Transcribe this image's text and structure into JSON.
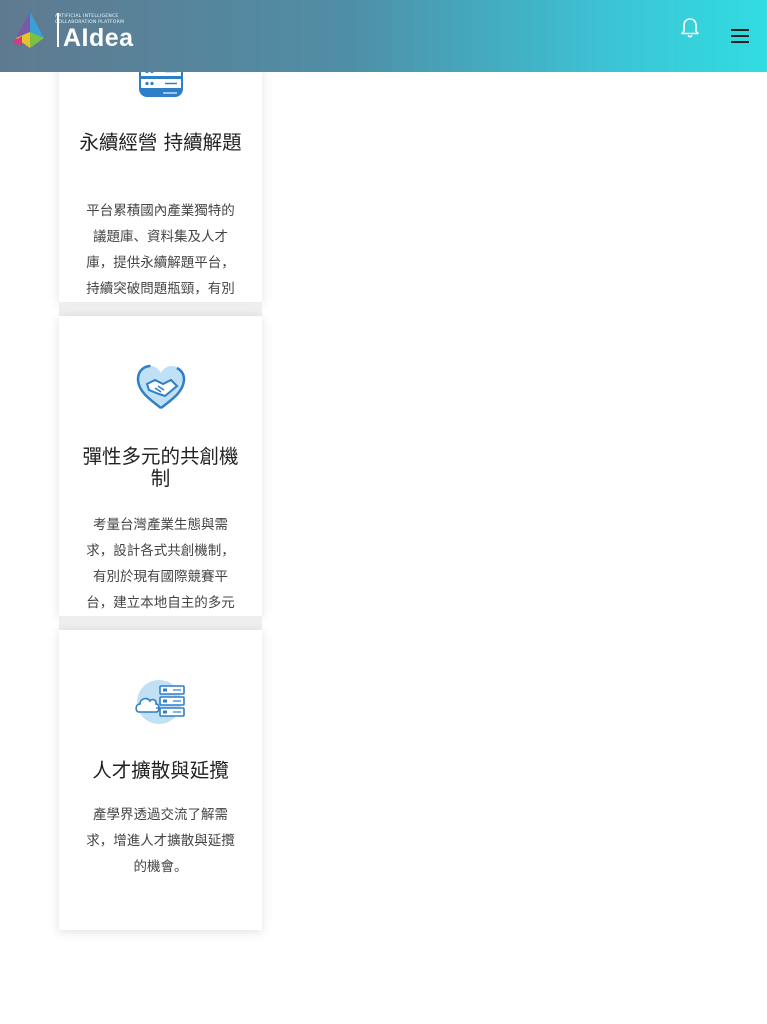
{
  "header": {
    "logo_subtitle": "Artificial Intelligence Collaboration Platform",
    "logo_text": "AIdea",
    "bell_icon": "bell-icon",
    "menu_icon": "hamburger-menu-icon",
    "gradient_start": "#5f7a90",
    "gradient_end": "#30dde0"
  },
  "cards": [
    {
      "icon": "server-stack-icon",
      "title": "永續經營 持續解題",
      "description": "平台累積國內產業獨特的議題庫、資料集及人才庫，提供永續解題平台，持續突破問題瓶頸，有別於其他一次性的競賽/媒合"
    },
    {
      "icon": "handshake-heart-icon",
      "title": "彈性多元的共創機制",
      "description": "考量台灣產業生態與需求，設計各式共創機制，有別於現有國際競賽平台，建立本地自主的多元共創模式"
    },
    {
      "icon": "cloud-server-icon",
      "title": "人才擴散與延攬",
      "description": "產學界透過交流了解需求，增進人才擴散與延攬的機會。"
    }
  ],
  "colors": {
    "icon_blue": "#2e7fc8",
    "icon_light": "#bfe0f5"
  }
}
